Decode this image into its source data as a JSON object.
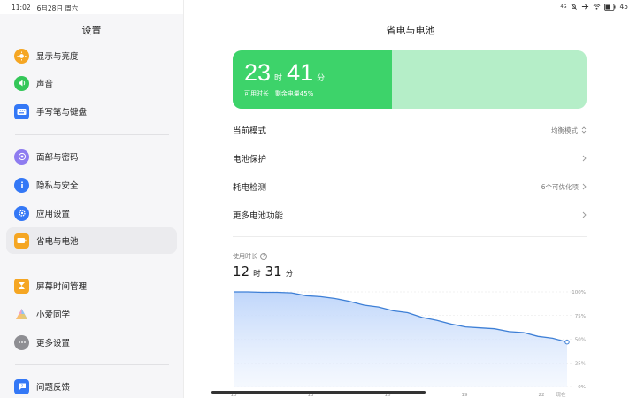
{
  "status": {
    "time": "11:02",
    "date": "6月28日 周六",
    "signal": "4G",
    "battery_pct": "45"
  },
  "sidebar": {
    "title": "设置",
    "items": [
      {
        "label": "显示与亮度",
        "icon": "sun-icon",
        "color": "#f5a623"
      },
      {
        "label": "声音",
        "icon": "speaker-icon",
        "color": "#34c759"
      },
      {
        "label": "手写笔与键盘",
        "icon": "keyboard-icon",
        "color": "#3478f6"
      },
      {
        "label": "面部与密码",
        "icon": "face-icon",
        "color": "#8e7cf0"
      },
      {
        "label": "隐私与安全",
        "icon": "privacy-icon",
        "color": "#3478f6"
      },
      {
        "label": "应用设置",
        "icon": "gear-icon",
        "color": "#3478f6"
      },
      {
        "label": "省电与电池",
        "icon": "battery-icon",
        "color": "#f5a623",
        "active": true
      },
      {
        "label": "屏幕时间管理",
        "icon": "hourglass-icon",
        "color": "#f5a623"
      },
      {
        "label": "小爱同学",
        "icon": "xiaoai-icon",
        "color": "#a56cf0"
      },
      {
        "label": "更多设置",
        "icon": "more-icon",
        "color": "#8e8e93"
      },
      {
        "label": "问题反馈",
        "icon": "feedback-icon",
        "color": "#3478f6"
      }
    ]
  },
  "main": {
    "title": "省电与电池",
    "battery": {
      "hours": "23",
      "hour_unit": "时",
      "minutes": "41",
      "minute_unit": "分",
      "subtitle": "可用时长 | 剩余电量45%",
      "level_pct": 45
    },
    "rows": [
      {
        "label": "当前模式",
        "value": "均衡模式"
      },
      {
        "label": "电池保护",
        "value": ""
      },
      {
        "label": "耗电检测",
        "value": "6个可优化项"
      },
      {
        "label": "更多电池功能",
        "value": ""
      }
    ],
    "usage": {
      "label": "使用时长",
      "hours": "12",
      "hour_unit": "时",
      "minutes": "31",
      "minute_unit": "分"
    }
  },
  "chart_data": {
    "type": "area",
    "x_tick_labels": [
      "10",
      "13",
      "16",
      "19",
      "22",
      "现在"
    ],
    "y_tick_labels": [
      "100%",
      "75%",
      "50%",
      "25%",
      "0%"
    ],
    "ylim": [
      0,
      100
    ],
    "series": [
      {
        "values": [
          100,
          100,
          99.5,
          99.5,
          99,
          96,
          95,
          93,
          90,
          86,
          84,
          80,
          78,
          73,
          70,
          66,
          63,
          62,
          61,
          58,
          57,
          53,
          51,
          47
        ]
      }
    ],
    "line_color": "#3d7fd6",
    "fill_color": "#cfe0fb"
  }
}
